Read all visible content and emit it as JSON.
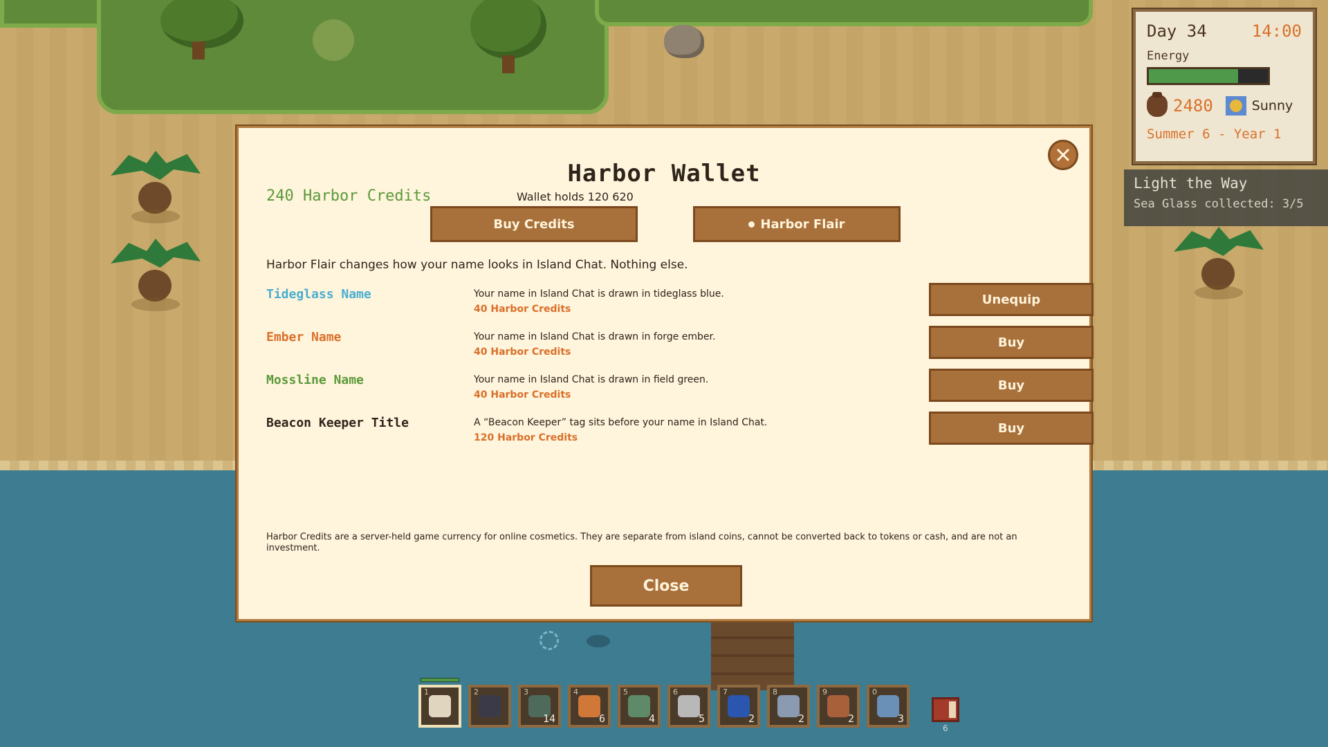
{
  "hud": {
    "day": "Day 34",
    "time": "14:00",
    "energy_label": "Energy",
    "energy_fraction": 0.75,
    "coins": "2480",
    "weather": "Sunny",
    "season": "Summer 6 - Year 1",
    "coin_icon": "coin-bag-icon",
    "weather_icon": "sun-icon"
  },
  "quest": {
    "title": "Light the Way",
    "progress": "Sea Glass collected: 3/5"
  },
  "modal": {
    "title": "Harbor Wallet",
    "balance": "240 Harbor Credits",
    "wallet_holds": "Wallet holds 120 620",
    "tabs": {
      "buy": "Buy Credits",
      "flair": "Harbor Flair",
      "active": "flair"
    },
    "flair_description": "Harbor Flair changes how your name looks in Island Chat. Nothing else.",
    "items": [
      {
        "name": "Tideglass Name",
        "color": "#4aaed0",
        "description": "Your name in Island Chat is drawn in tideglass blue.",
        "price": "40 Harbor Credits",
        "action": "Unequip"
      },
      {
        "name": "Ember Name",
        "color": "#d9702a",
        "description": "Your name in Island Chat is drawn in forge ember.",
        "price": "40 Harbor Credits",
        "action": "Buy"
      },
      {
        "name": "Mossline Name",
        "color": "#5a9a3a",
        "description": "Your name in Island Chat is drawn in field green.",
        "price": "40 Harbor Credits",
        "action": "Buy"
      },
      {
        "name": "Beacon Keeper Title",
        "color": "#2e241a",
        "description": "A “Beacon Keeper” tag sits before your name in Island Chat.",
        "price": "120 Harbor Credits",
        "action": "Buy"
      }
    ],
    "disclaimer": "Harbor Credits are a server-held game currency for online cosmetics. They are separate from island coins, cannot be converted back to tokens or cash, and are not an investment.",
    "close_label": "Close"
  },
  "hotbar": {
    "slots": [
      {
        "key": "1",
        "icon": "pickaxe-icon",
        "count": "",
        "color": "#e0d6c0"
      },
      {
        "key": "2",
        "icon": "axe-icon",
        "count": "",
        "color": "#3a3a48"
      },
      {
        "key": "3",
        "icon": "stone-icon",
        "count": "14",
        "color": "#4e6a5a"
      },
      {
        "key": "4",
        "icon": "wood-icon",
        "count": "6",
        "color": "#d07838"
      },
      {
        "key": "5",
        "icon": "fiber-icon",
        "count": "4",
        "color": "#5e8a6a"
      },
      {
        "key": "6",
        "icon": "ore-icon",
        "count": "5",
        "color": "#b8b8b8"
      },
      {
        "key": "7",
        "icon": "sapphire-icon",
        "count": "2",
        "color": "#2a56b0"
      },
      {
        "key": "8",
        "icon": "iron-bar-icon",
        "count": "2",
        "color": "#8a9ab0"
      },
      {
        "key": "9",
        "icon": "plank-icon",
        "count": "2",
        "color": "#a8603a"
      },
      {
        "key": "0",
        "icon": "gem-icon",
        "count": "3",
        "color": "#6a90b8"
      }
    ],
    "journal_count": "6"
  }
}
